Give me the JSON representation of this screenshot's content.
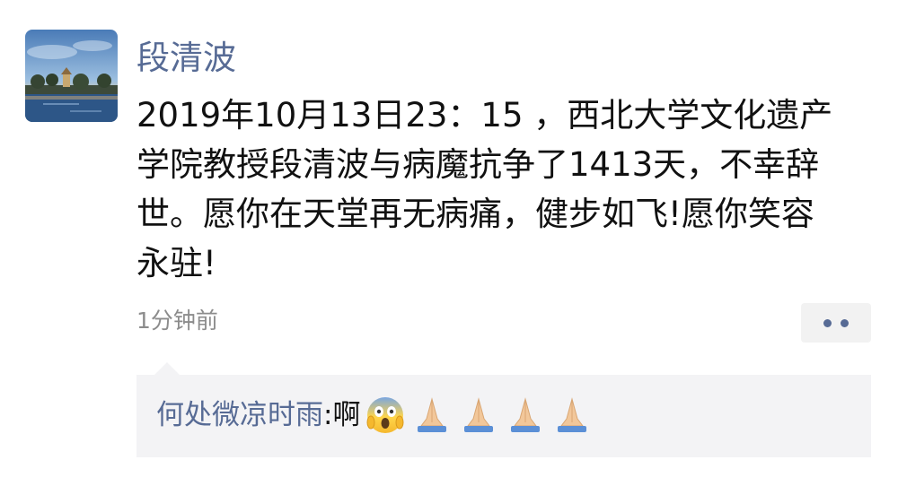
{
  "post": {
    "author": "段清波",
    "text": "2019年10月13日23：15 ，西北大学文化遗产学院教授段清波与病魔抗争了1413天，不幸辞世。愿你在天堂再无病痛，健步如飞!愿你笑容永驻!",
    "timestamp": "1分钟前",
    "avatar": "lakeside-landscape-photo"
  },
  "actions": {
    "more_icon": "more-dots-icon"
  },
  "comment": {
    "commenter": "何处微凉时雨",
    "separator": ": ",
    "text": "啊",
    "emojis": [
      "face-screaming-in-fear-icon",
      "folded-hands-icon",
      "folded-hands-icon",
      "folded-hands-icon",
      "folded-hands-icon"
    ]
  },
  "colors": {
    "link_blue": "#576b95",
    "comment_bg": "#f3f3f5",
    "timestamp_gray": "#8c8c8c"
  }
}
